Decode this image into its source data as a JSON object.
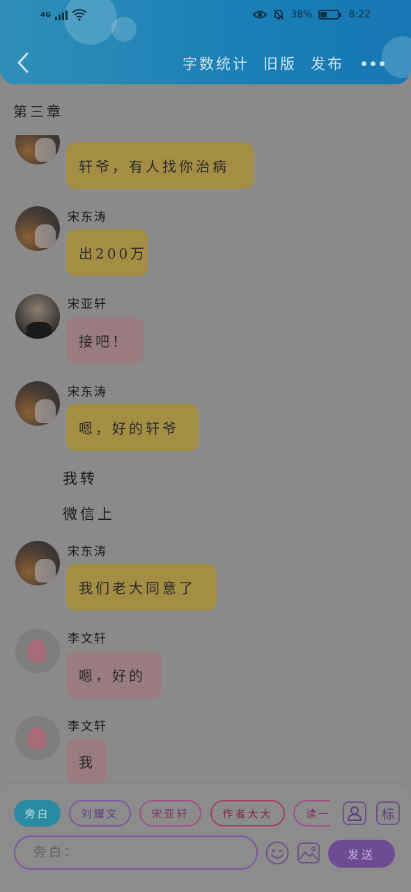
{
  "status_bar": {
    "network": "4G",
    "battery": "38%",
    "battery_level": 0.38,
    "time": "8:22"
  },
  "header": {
    "actions": [
      "字数统计",
      "旧版",
      "发布"
    ]
  },
  "chapter_title": "第三章",
  "messages": [
    {
      "type": "bubble",
      "sender": "",
      "text": "轩爷，有人找你治病",
      "color": "yellow",
      "avatar": "dusk-avatar"
    },
    {
      "type": "bubble",
      "sender": "宋东涛",
      "text": "出200万",
      "color": "yellow",
      "avatar": "dusk-avatar"
    },
    {
      "type": "bubble",
      "sender": "宋亚轩",
      "text": "接吧！",
      "color": "pink",
      "avatar": "boy-avatar"
    },
    {
      "type": "bubble",
      "sender": "宋东涛",
      "text": "嗯，好的轩爷",
      "color": "yellow",
      "avatar": "dusk-avatar"
    },
    {
      "type": "plain",
      "text": "我转"
    },
    {
      "type": "plain",
      "text": "微信上"
    },
    {
      "type": "bubble",
      "sender": "宋东涛",
      "text": "我们老大同意了",
      "color": "yellow",
      "avatar": "dusk-avatar"
    },
    {
      "type": "bubble",
      "sender": "李文轩",
      "text": "嗯，好的",
      "color": "pink",
      "avatar": "star-avatar"
    },
    {
      "type": "bubble",
      "sender": "李文轩",
      "text": "我",
      "color": "pink",
      "avatar": "star-avatar"
    }
  ],
  "composer": {
    "roles": [
      "旁白",
      "刘耀文",
      "宋亚轩",
      "作者大大",
      "读一"
    ],
    "active_role": "旁白",
    "tag_icon_label": "标",
    "input_placeholder": "旁白：",
    "send_label": "发送"
  },
  "colors": {
    "header": "#1a7fb6",
    "bubble_yellow": "#a48e44",
    "bubble_pink": "#9a7b80",
    "send_button": "#6c4c92",
    "active_chip": "#2a8aa2"
  }
}
